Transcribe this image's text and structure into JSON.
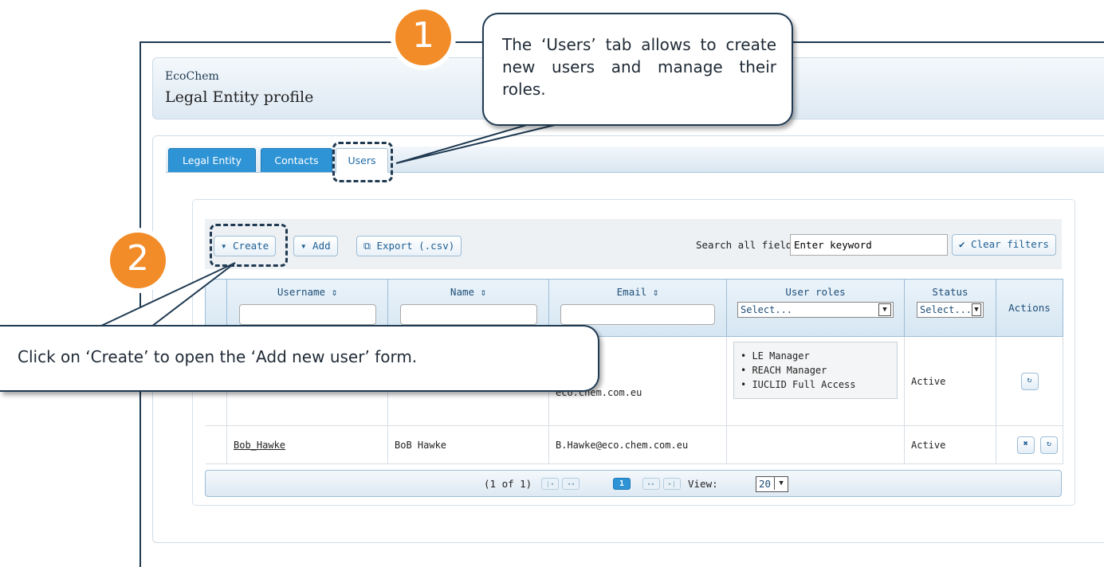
{
  "header": {
    "org": "EcoChem",
    "title": "Legal Entity profile"
  },
  "tabs": [
    {
      "label": "Legal Entity"
    },
    {
      "label": "Contacts"
    },
    {
      "label": "Users"
    }
  ],
  "toolbar": {
    "create": "▾ Create",
    "add": "▾ Add",
    "export": "⧉ Export (.csv)",
    "search_label": "Search all fields:",
    "search_value": "Enter keyword",
    "clear": "✔ Clear filters"
  },
  "table": {
    "headers": [
      "Username ⇕",
      "Name ⇕",
      "Email ⇕",
      "User roles",
      "Status",
      "Actions"
    ],
    "roles_filter": "Select...",
    "status_filter": "Select...",
    "rows": [
      {
        "username": "",
        "name": "",
        "email": "eco.chem.com.eu",
        "roles": [
          "LE Manager",
          "REACH Manager",
          "IUCLID Full Access"
        ],
        "status": "Active"
      },
      {
        "username": "Bob_Hawke",
        "name": "BoB Hawke",
        "email": "B.Hawke@eco.chem.com.eu",
        "roles": [],
        "status": "Active"
      }
    ]
  },
  "pager": {
    "info": "(1 of 1)",
    "current": "1",
    "view_label": "View:",
    "view_value": "20"
  },
  "annotations": {
    "badge1": "1",
    "badge2": "2",
    "callout1": "The ‘Users’ tab allows to create new users and manage their roles.",
    "callout2": "Click on ‘Create’ to open the ‘Add new user’ form."
  },
  "colors": {
    "accent": "#2e94d6",
    "badge": "#f28c28",
    "outline": "#1f3a52"
  }
}
